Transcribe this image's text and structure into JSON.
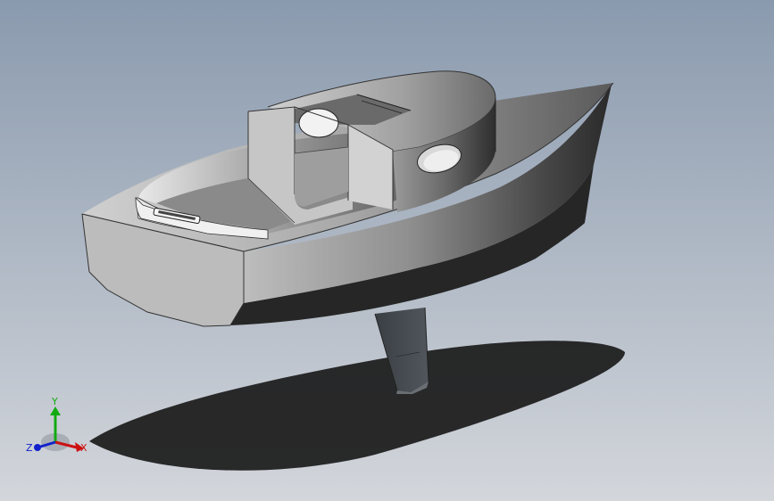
{
  "colors": {
    "background_top": "#8c9cb0",
    "background_bottom": "#d0d4da",
    "shadow": "#1a1a1a",
    "hull_dark": "#2a2a2a",
    "hull_light": "#c8c8c8",
    "axis_x": "#cc1111",
    "axis_y": "#11aa11",
    "axis_z": "#1122cc"
  },
  "triad": {
    "x_label": "X",
    "y_label": "Y",
    "z_label": "Z"
  }
}
